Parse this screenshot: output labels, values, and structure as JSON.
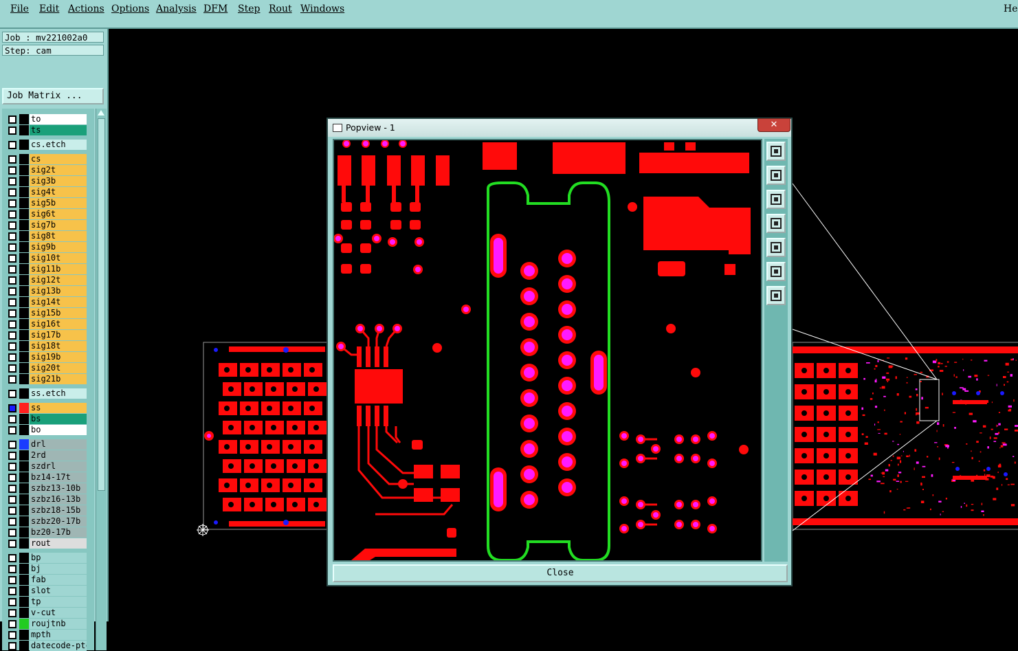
{
  "menu": {
    "file": "File",
    "edit": "Edit",
    "actions": "Actions",
    "options": "Options",
    "analysis": "Analysis",
    "dfm": "DFM",
    "step": "Step",
    "rout": "Rout",
    "windows": "Windows",
    "help": "Hel"
  },
  "job": {
    "job_label": "Job : mv221002a0",
    "step_label": "Step: cam",
    "job_matrix_button": "Job Matrix ..."
  },
  "layers": [
    {
      "name": "to",
      "color": "#ffffff",
      "swatch": ""
    },
    {
      "name": "ts",
      "color": "#1aa07a",
      "swatch": ""
    },
    {
      "name": "cs.etch",
      "color": "#c9eeea",
      "swatch": "",
      "gap": true
    },
    {
      "name": "cs",
      "color": "#f7c24a",
      "swatch": "",
      "gap": true
    },
    {
      "name": "sig2t",
      "color": "#f7c24a",
      "swatch": ""
    },
    {
      "name": "sig3b",
      "color": "#f7c24a",
      "swatch": ""
    },
    {
      "name": "sig4t",
      "color": "#f7c24a",
      "swatch": ""
    },
    {
      "name": "sig5b",
      "color": "#f7c24a",
      "swatch": ""
    },
    {
      "name": "sig6t",
      "color": "#f7c24a",
      "swatch": ""
    },
    {
      "name": "sig7b",
      "color": "#f7c24a",
      "swatch": ""
    },
    {
      "name": "sig8t",
      "color": "#f7c24a",
      "swatch": ""
    },
    {
      "name": "sig9b",
      "color": "#f7c24a",
      "swatch": ""
    },
    {
      "name": "sig10t",
      "color": "#f7c24a",
      "swatch": ""
    },
    {
      "name": "sig11b",
      "color": "#f7c24a",
      "swatch": ""
    },
    {
      "name": "sig12t",
      "color": "#f7c24a",
      "swatch": ""
    },
    {
      "name": "sig13b",
      "color": "#f7c24a",
      "swatch": ""
    },
    {
      "name": "sig14t",
      "color": "#f7c24a",
      "swatch": ""
    },
    {
      "name": "sig15b",
      "color": "#f7c24a",
      "swatch": ""
    },
    {
      "name": "sig16t",
      "color": "#f7c24a",
      "swatch": ""
    },
    {
      "name": "sig17b",
      "color": "#f7c24a",
      "swatch": ""
    },
    {
      "name": "sig18t",
      "color": "#f7c24a",
      "swatch": ""
    },
    {
      "name": "sig19b",
      "color": "#f7c24a",
      "swatch": ""
    },
    {
      "name": "sig20t",
      "color": "#f7c24a",
      "swatch": ""
    },
    {
      "name": "sig21b",
      "color": "#f7c24a",
      "swatch": ""
    },
    {
      "name": "ss.etch",
      "color": "#c9eeea",
      "swatch": "",
      "gap": true
    },
    {
      "name": "ss",
      "color": "#f7c24a",
      "swatch": "#ff2020",
      "gap": true,
      "active": true
    },
    {
      "name": "bs",
      "color": "#1aa07a",
      "swatch": ""
    },
    {
      "name": "bo",
      "color": "#ffffff",
      "swatch": ""
    },
    {
      "name": "drl",
      "color": "#9fb6b4",
      "swatch": "#1a3cff",
      "gap": true
    },
    {
      "name": "2rd",
      "color": "#9fb6b4",
      "swatch": ""
    },
    {
      "name": "szdrl",
      "color": "#9fb6b4",
      "swatch": ""
    },
    {
      "name": "bz14-17t",
      "color": "#9fb6b4",
      "swatch": ""
    },
    {
      "name": "szbz13-10b",
      "color": "#9fb6b4",
      "swatch": ""
    },
    {
      "name": "szbz16-13b",
      "color": "#9fb6b4",
      "swatch": ""
    },
    {
      "name": "szbz18-15b",
      "color": "#9fb6b4",
      "swatch": ""
    },
    {
      "name": "szbz20-17b",
      "color": "#9fb6b4",
      "swatch": ""
    },
    {
      "name": "bz20-17b",
      "color": "#9fb6b4",
      "swatch": ""
    },
    {
      "name": "rout",
      "color": "#dddddd",
      "swatch": ""
    },
    {
      "name": "bp",
      "color": "#9fd6d2",
      "swatch": "",
      "gap": true
    },
    {
      "name": "bj",
      "color": "#9fd6d2",
      "swatch": ""
    },
    {
      "name": "fab",
      "color": "#9fd6d2",
      "swatch": ""
    },
    {
      "name": "slot",
      "color": "#9fd6d2",
      "swatch": ""
    },
    {
      "name": "tp",
      "color": "#9fd6d2",
      "swatch": ""
    },
    {
      "name": "v-cut",
      "color": "#9fd6d2",
      "swatch": ""
    },
    {
      "name": "roujtnb",
      "color": "#9fd6d2",
      "swatch": "#22cc22"
    },
    {
      "name": "mpth",
      "color": "#9fd6d2",
      "swatch": ""
    },
    {
      "name": "datecode-ptc",
      "color": "#9fd6d2",
      "swatch": ""
    }
  ],
  "popview": {
    "title": "Popview - 1",
    "close_x": "✕",
    "close_button": "Close",
    "tools": [
      "zoom-fit-icon",
      "pan-up-icon",
      "pan-down-icon",
      "pan-left-icon",
      "pan-right-icon",
      "zoom-out-icon",
      "zoom-home-icon"
    ]
  },
  "colors": {
    "copper": "#ff0a0a",
    "pad_center": "#ff1aff",
    "rout_outline": "#22dd22",
    "drill_blue": "#1a1aff",
    "panel_bg": "#9fd6d2"
  }
}
